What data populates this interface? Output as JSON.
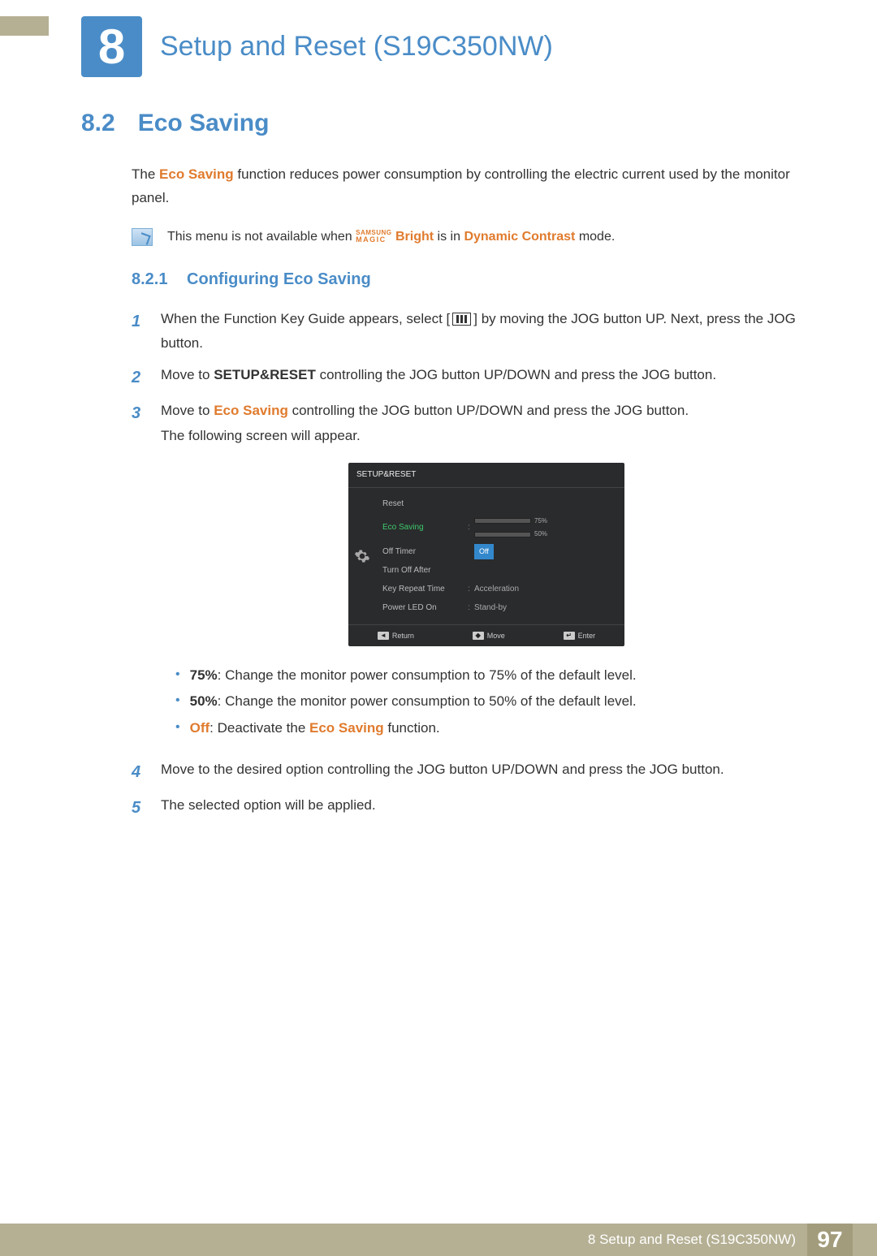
{
  "chapter": {
    "number": "8",
    "title": "Setup and Reset (S19C350NW)"
  },
  "section": {
    "number": "8.2",
    "title": "Eco Saving"
  },
  "intro": {
    "pre": "The ",
    "term": "Eco Saving",
    "post": " function reduces power consumption by controlling the electric current used by the monitor panel."
  },
  "note": {
    "pre": "This menu is not available when ",
    "magic_top": "SAMSUNG",
    "magic_bot": "MAGIC",
    "bright": "Bright",
    "mid": " is in ",
    "mode": "Dynamic Contrast",
    "post": " mode."
  },
  "sub": {
    "number": "8.2.1",
    "title": "Configuring Eco Saving"
  },
  "steps": {
    "s1": {
      "pre": "When the Function Key Guide appears, select [",
      "post": "] by moving the JOG button UP. Next, press the JOG button."
    },
    "s2": {
      "pre": "Move to ",
      "target": "SETUP&RESET",
      "post": " controlling the JOG button UP/DOWN and press the JOG button."
    },
    "s3": {
      "pre": "Move to ",
      "target": "Eco Saving",
      "mid": " controlling the JOG button UP/DOWN and press the JOG button.",
      "line2": "The following screen will appear."
    },
    "s4": "Move to the desired option controlling the JOG button UP/DOWN and press the JOG button.",
    "s5": "The selected option will be applied."
  },
  "osd": {
    "title": "SETUP&RESET",
    "items": [
      {
        "label": "Reset",
        "value": ""
      },
      {
        "label": "Eco Saving",
        "value": ""
      },
      {
        "label": "Off Timer",
        "value": "Off"
      },
      {
        "label": "Turn Off After",
        "value": ""
      },
      {
        "label": "Key Repeat Time",
        "value": "Acceleration"
      },
      {
        "label": "Power LED On",
        "value": "Stand-by"
      }
    ],
    "bars": [
      {
        "pct": 75,
        "label": "75%"
      },
      {
        "pct": 50,
        "label": "50%"
      }
    ],
    "footer": {
      "return": "Return",
      "move": "Move",
      "enter": "Enter"
    }
  },
  "bullets": {
    "b1": {
      "term": "75%",
      "text": ": Change the monitor power consumption to 75% of the default level."
    },
    "b2": {
      "term": "50%",
      "text": ": Change the monitor power consumption to 50% of the default level."
    },
    "b3": {
      "term": "Off",
      "mid": ": Deactivate the ",
      "term2": "Eco Saving",
      "post": " function."
    }
  },
  "footer": {
    "text": "8 Setup and Reset (S19C350NW)",
    "page": "97"
  }
}
